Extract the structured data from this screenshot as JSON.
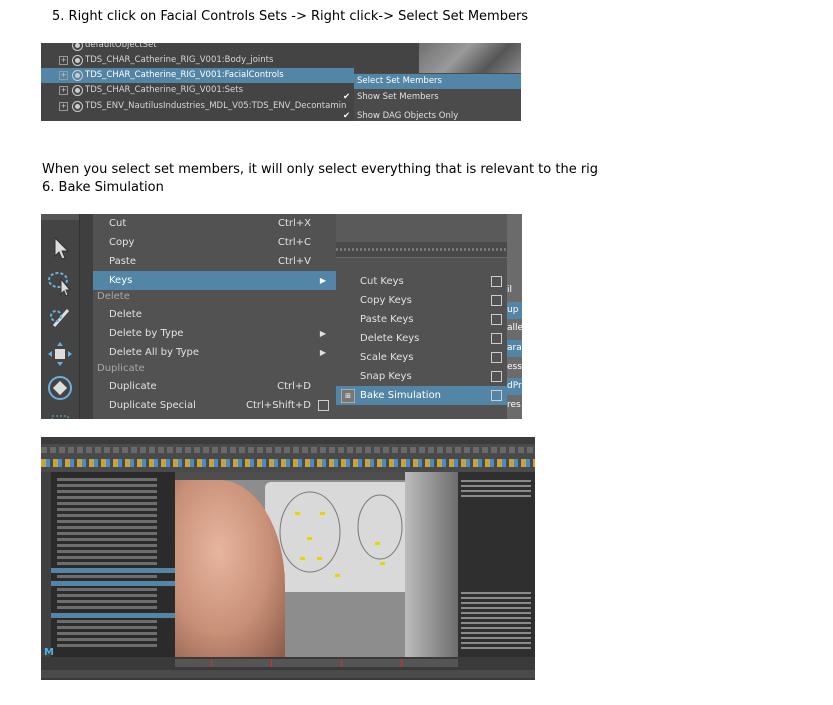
{
  "step5": "5.   Right click on Facial Controls Sets -> Right click-> Select Set Members",
  "note": "When you select set members, it will only select everything that is relevant to the rig",
  "step6": "6. Bake Simulation",
  "outliner": {
    "rows": [
      {
        "label": "defaultObjectSet",
        "expander": ""
      },
      {
        "label": "TDS_CHAR_Catherine_RIG_V001:Body_joints",
        "expander": "+"
      },
      {
        "label": "TDS_CHAR_Catherine_RIG_V001:FacialControls",
        "expander": "+"
      },
      {
        "label": "TDS_CHAR_Catherine_RIG_V001:Sets",
        "expander": "+"
      },
      {
        "label": "TDS_ENV_NautilusIndustries_MDL_V05:TDS_ENV_Decontamin",
        "expander": "+"
      }
    ],
    "context_menu": [
      {
        "label": "Select Set Members",
        "checked": false
      },
      {
        "label": "Show Set Members",
        "checked": true
      },
      {
        "label": "Show DAG Objects Only",
        "checked": true
      }
    ]
  },
  "edit_menu": {
    "items": [
      {
        "label": "Cut",
        "shortcut": "Ctrl+X"
      },
      {
        "label": "Copy",
        "shortcut": "Ctrl+C"
      },
      {
        "label": "Paste",
        "shortcut": "Ctrl+V"
      },
      {
        "label": "Keys",
        "shortcut": "",
        "submenu": true
      },
      {
        "label": "Delete",
        "header": true
      },
      {
        "label": "Delete",
        "shortcut": ""
      },
      {
        "label": "Delete by Type",
        "shortcut": "",
        "submenu": true
      },
      {
        "label": "Delete All by Type",
        "shortcut": "",
        "submenu": true
      },
      {
        "label": "Duplicate",
        "header": true
      },
      {
        "label": "Duplicate",
        "shortcut": "Ctrl+D"
      },
      {
        "label": "Duplicate Special",
        "shortcut": "Ctrl+Shift+D"
      }
    ],
    "keys_submenu": [
      {
        "label": "Cut Keys"
      },
      {
        "label": "Copy Keys"
      },
      {
        "label": "Paste Keys"
      },
      {
        "label": "Delete Keys"
      },
      {
        "label": "Scale Keys"
      },
      {
        "label": "Snap Keys"
      },
      {
        "label": "Bake Simulation"
      }
    ],
    "right_fragments": [
      "il",
      "up",
      "alle",
      "ara",
      "ess",
      "dPr",
      "res"
    ]
  },
  "maya_window": {
    "menu_letter": "M"
  },
  "colors": {
    "highlight": "#5285a6",
    "menu_bg": "#525252",
    "maya_bg": "#444444"
  }
}
